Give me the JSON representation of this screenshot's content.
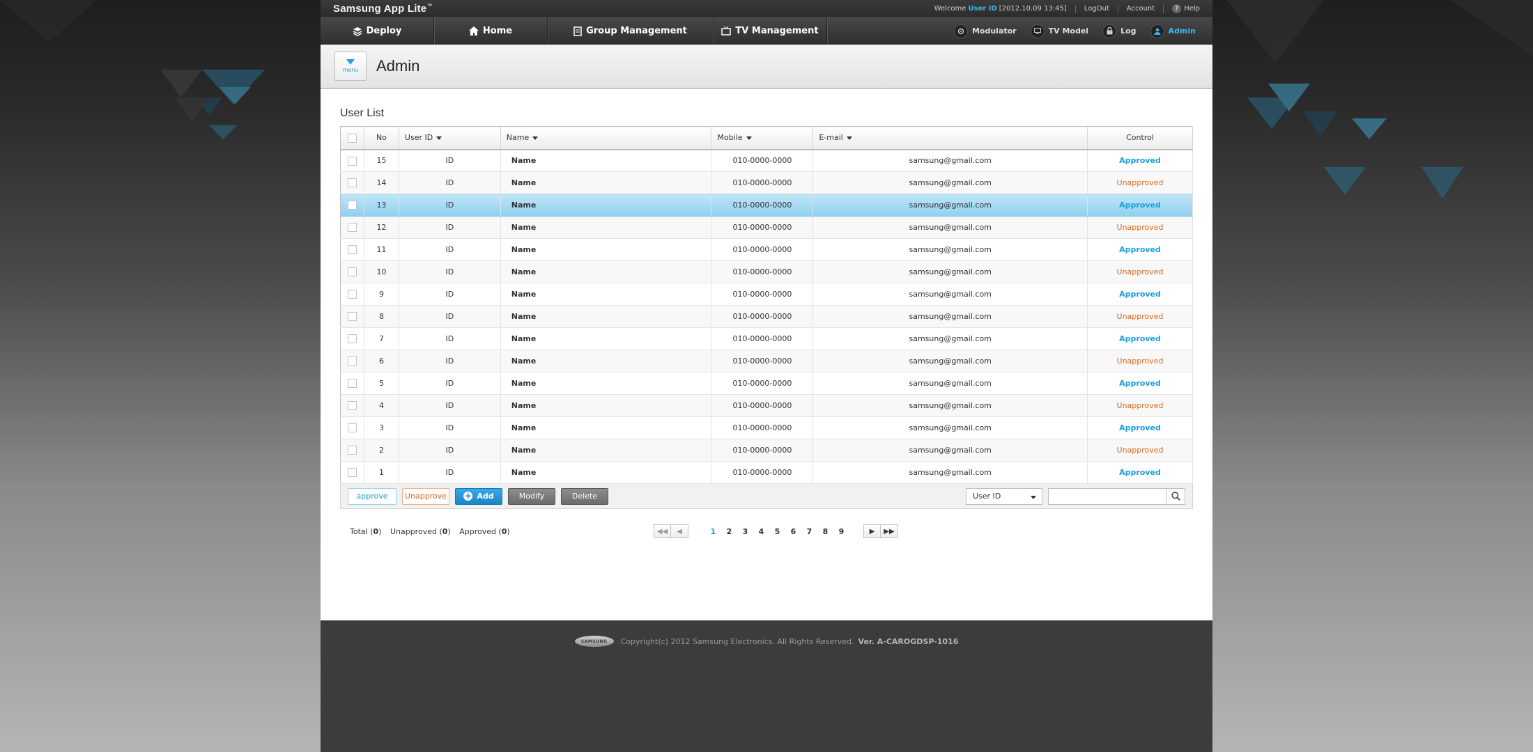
{
  "app": {
    "title": "Samsung App Lite",
    "trademark": "™"
  },
  "topbar": {
    "welcome": "Welcome",
    "user_id": "User ID",
    "datetime": "[2012.10.09 13:45]",
    "logout": "LogOut",
    "account": "Account",
    "help": "Help"
  },
  "nav": {
    "items": [
      {
        "label": "Deploy",
        "icon": "layers-icon"
      },
      {
        "label": "Home",
        "icon": "home-icon"
      },
      {
        "label": "Group Management",
        "icon": "document-icon"
      },
      {
        "label": "TV Management",
        "icon": "tv-icon"
      }
    ],
    "tools": [
      {
        "label": "Modulator",
        "icon": "modulator-icon"
      },
      {
        "label": "TV Model",
        "icon": "tv-model-icon"
      },
      {
        "label": "Log",
        "icon": "lock-icon"
      },
      {
        "label": "Admin",
        "icon": "user-icon",
        "active": true
      }
    ]
  },
  "page": {
    "menu_label": "menu",
    "title": "Admin"
  },
  "user_list": {
    "title": "User List",
    "columns": {
      "no": "No",
      "user_id": "User ID",
      "name": "Name",
      "mobile": "Mobile",
      "email": "E-mail",
      "control": "Control"
    },
    "rows": [
      {
        "no": "15",
        "user_id": "ID",
        "name": "Name",
        "mobile": "010-0000-0000",
        "email": "samsung@gmail.com",
        "control": "Approved"
      },
      {
        "no": "14",
        "user_id": "ID",
        "name": "Name",
        "mobile": "010-0000-0000",
        "email": "samsung@gmail.com",
        "control": "Unapproved"
      },
      {
        "no": "13",
        "user_id": "ID",
        "name": "Name",
        "mobile": "010-0000-0000",
        "email": "samsung@gmail.com",
        "control": "Approved",
        "selected": true
      },
      {
        "no": "12",
        "user_id": "ID",
        "name": "Name",
        "mobile": "010-0000-0000",
        "email": "samsung@gmail.com",
        "control": "Unapproved"
      },
      {
        "no": "11",
        "user_id": "ID",
        "name": "Name",
        "mobile": "010-0000-0000",
        "email": "samsung@gmail.com",
        "control": "Approved"
      },
      {
        "no": "10",
        "user_id": "ID",
        "name": "Name",
        "mobile": "010-0000-0000",
        "email": "samsung@gmail.com",
        "control": "Unapproved"
      },
      {
        "no": "9",
        "user_id": "ID",
        "name": "Name",
        "mobile": "010-0000-0000",
        "email": "samsung@gmail.com",
        "control": "Approved"
      },
      {
        "no": "8",
        "user_id": "ID",
        "name": "Name",
        "mobile": "010-0000-0000",
        "email": "samsung@gmail.com",
        "control": "Unapproved"
      },
      {
        "no": "7",
        "user_id": "ID",
        "name": "Name",
        "mobile": "010-0000-0000",
        "email": "samsung@gmail.com",
        "control": "Approved"
      },
      {
        "no": "6",
        "user_id": "ID",
        "name": "Name",
        "mobile": "010-0000-0000",
        "email": "samsung@gmail.com",
        "control": "Unapproved"
      },
      {
        "no": "5",
        "user_id": "ID",
        "name": "Name",
        "mobile": "010-0000-0000",
        "email": "samsung@gmail.com",
        "control": "Approved"
      },
      {
        "no": "4",
        "user_id": "ID",
        "name": "Name",
        "mobile": "010-0000-0000",
        "email": "samsung@gmail.com",
        "control": "Unapproved"
      },
      {
        "no": "3",
        "user_id": "ID",
        "name": "Name",
        "mobile": "010-0000-0000",
        "email": "samsung@gmail.com",
        "control": "Approved"
      },
      {
        "no": "2",
        "user_id": "ID",
        "name": "Name",
        "mobile": "010-0000-0000",
        "email": "samsung@gmail.com",
        "control": "Unapproved"
      },
      {
        "no": "1",
        "user_id": "ID",
        "name": "Name",
        "mobile": "010-0000-0000",
        "email": "samsung@gmail.com",
        "control": "Approved"
      }
    ]
  },
  "actions": {
    "approve": "approve",
    "unapprove": "Unapprove",
    "add": "Add",
    "modify": "Modify",
    "delete": "Delete",
    "search_field": "User ID"
  },
  "summary": {
    "total_label": "Total",
    "total": "0",
    "unapproved_label": "Unapproved",
    "unapproved": "0",
    "approved_label": "Approved",
    "approved": "0"
  },
  "pagination": {
    "pages": [
      "1",
      "2",
      "3",
      "4",
      "5",
      "6",
      "7",
      "8",
      "9"
    ],
    "current": "1"
  },
  "footer": {
    "logo": "SAMSUNG",
    "copyright": "Copyright(c) 2012 Samsung Electronics. All Rights Reserved.",
    "version": "Ver. A-CAROGDSP-1016"
  },
  "colors": {
    "accent": "#1a9fe0",
    "unapproved": "#e0681a",
    "selected_row": "#8fd0ef"
  }
}
